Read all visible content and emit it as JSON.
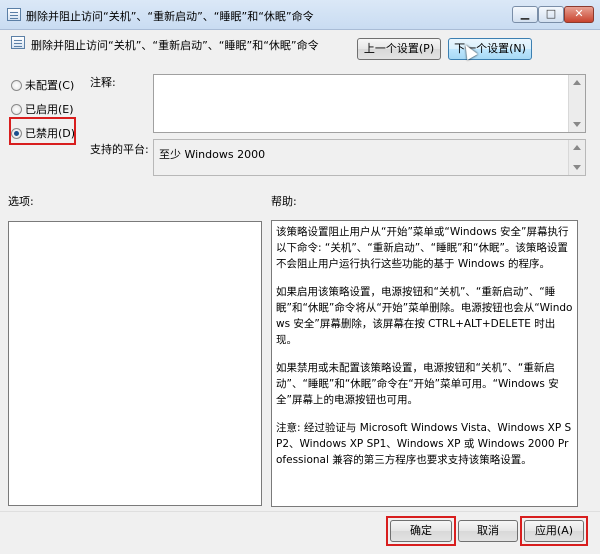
{
  "window": {
    "title": "删除并阻止访问“关机”、“重新启动”、“睡眠”和“休眠”命令",
    "min_glyph": "▁",
    "max_glyph": "□",
    "close_glyph": "✕"
  },
  "header": {
    "policy_name": "删除并阻止访问“关机”、“重新启动”、“睡眠”和“休眠”命令",
    "prev_button": "上一个设置(P)",
    "next_button": "下一个设置(N)"
  },
  "state": {
    "options": [
      {
        "label": "未配置(C)",
        "selected": false
      },
      {
        "label": "已启用(E)",
        "selected": false
      },
      {
        "label": "已禁用(D)",
        "selected": true
      }
    ]
  },
  "comment": {
    "label": "注释:",
    "value": ""
  },
  "platform": {
    "label": "支持的平台:",
    "value": "至少 Windows 2000"
  },
  "options_section": {
    "label": "选项:"
  },
  "help": {
    "label": "帮助:",
    "paragraphs": [
      "该策略设置阻止用户从“开始”菜单或“Windows 安全”屏幕执行以下命令: “关机”、“重新启动”、“睡眠”和“休眠”。该策略设置不会阻止用户运行执行这些功能的基于 Windows 的程序。",
      "如果启用该策略设置，电源按钮和“关机”、“重新启动”、“睡眠”和“休眠”命令将从“开始”菜单删除。电源按钮也会从“Windows 安全”屏幕删除，该屏幕在按 CTRL+ALT+DELETE 时出现。",
      "如果禁用或未配置该策略设置，电源按钮和“关机”、“重新启动”、“睡眠”和“休眠”命令在“开始”菜单可用。“Windows 安全”屏幕上的电源按钮也可用。",
      "注意: 经过验证与 Microsoft Windows Vista、Windows XP SP2、Windows XP SP1、Windows XP 或 Windows 2000 Professional 兼容的第三方程序也要求支持该策略设置。"
    ]
  },
  "footer": {
    "ok": "确定",
    "cancel": "取消",
    "apply": "应用(A)"
  },
  "colors": {
    "highlight_frame": "#d81e1e",
    "window_bg": "#f0f0f0",
    "titlebar": "#c9dcf2"
  }
}
